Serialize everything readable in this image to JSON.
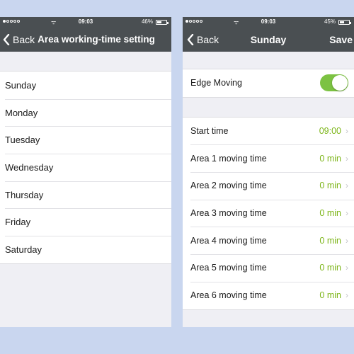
{
  "left": {
    "status": {
      "time": "09:03",
      "battery": "46%"
    },
    "nav": {
      "back_label": "Back",
      "title": "Area working-time setting"
    },
    "days": [
      "Sunday",
      "Monday",
      "Tuesday",
      "Wednesday",
      "Thursday",
      "Friday",
      "Saturday"
    ]
  },
  "right": {
    "status": {
      "time": "09:03",
      "battery": "45%"
    },
    "nav": {
      "back_label": "Back",
      "title": "Sunday",
      "save_label": "Save"
    },
    "edge_moving": {
      "label": "Edge Moving",
      "enabled": true
    },
    "settings": [
      {
        "label": "Start time",
        "value": "09:00"
      },
      {
        "label": "Area 1 moving time",
        "value": "0 min"
      },
      {
        "label": "Area 2 moving time",
        "value": "0 min"
      },
      {
        "label": "Area 3 moving time",
        "value": "0 min"
      },
      {
        "label": "Area 4 moving time",
        "value": "0 min"
      },
      {
        "label": "Area 5 moving time",
        "value": "0 min"
      },
      {
        "label": "Area 6 moving time",
        "value": "0 min"
      }
    ]
  },
  "colors": {
    "nav_bg": "#4a4f52",
    "accent_green": "#7cc242",
    "value_green": "#7cb518",
    "page_bg": "#c9d6ef"
  }
}
